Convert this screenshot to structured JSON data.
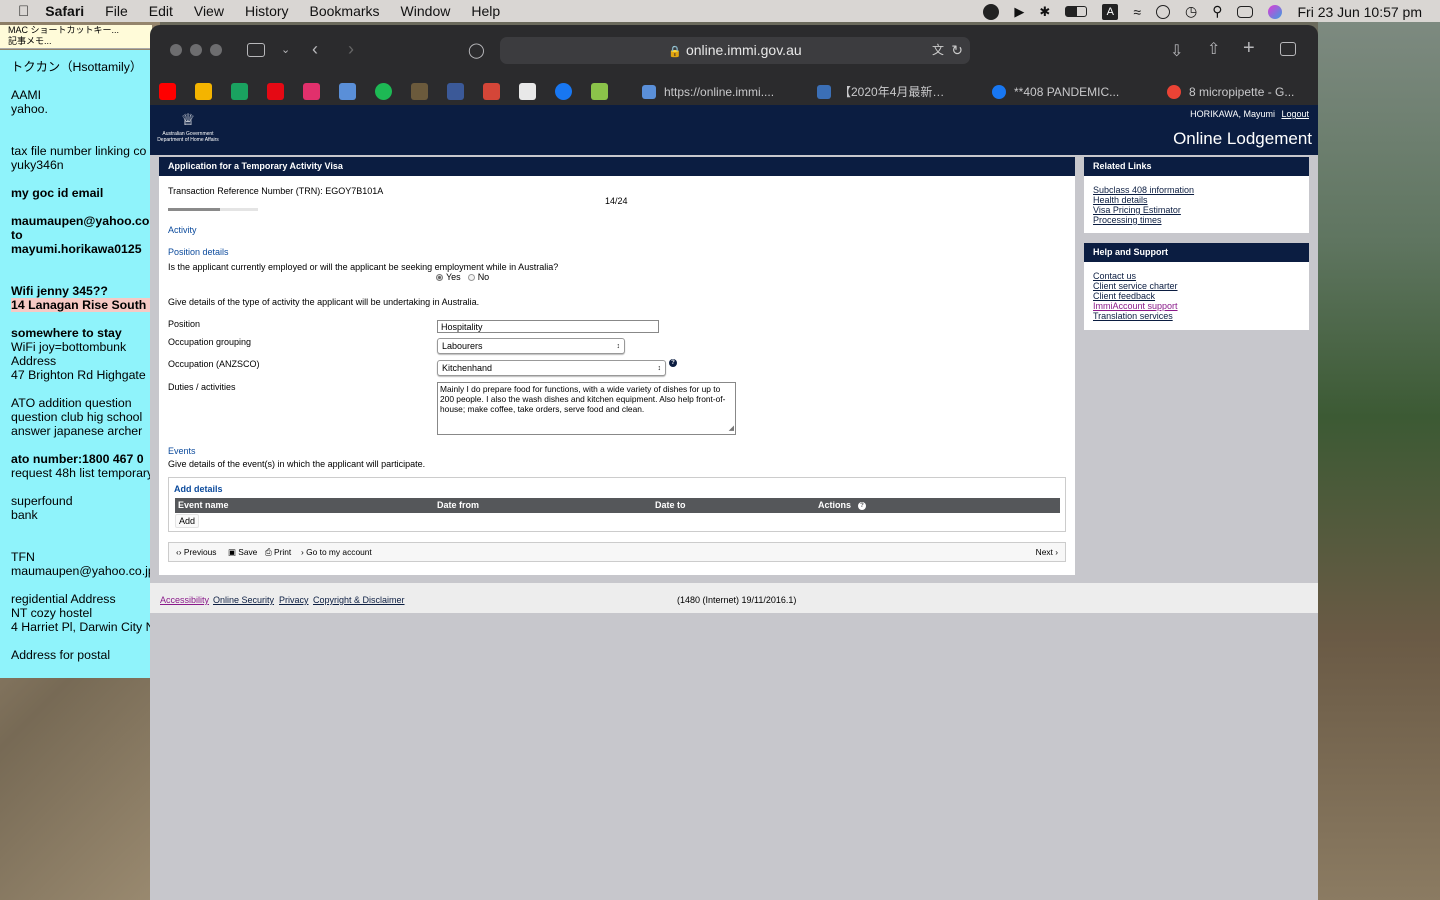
{
  "menubar": {
    "app_name": "Safari",
    "items": [
      "File",
      "Edit",
      "View",
      "History",
      "Bookmarks",
      "Window",
      "Help"
    ],
    "clock": "Fri 23 Jun  10:57 pm"
  },
  "memo": {
    "title_bar_1": "MAC ショートカットキー...",
    "title_bar_2": "記事メモ...",
    "lines": [
      "トクカン（Hsottamily）",
      "",
      "AAMI",
      "yahoo.",
      "",
      "",
      "tax file number linking co",
      "yuky346n",
      "",
      "my goc id email",
      "",
      "maumaupen@yahoo.co",
      "to",
      "mayumi.horikawa0125",
      "",
      "",
      "Wifi jenny 345??",
      "14 Lanagan Rise South",
      "",
      "somewhere to stay",
      "WiFi joy=bottombunk",
      "Address",
      "47 Brighton Rd Highgate",
      "",
      "ATO addition question",
      "question club hig school",
      "answer japanese archer",
      "",
      "ato number:1800 467 0",
      "request 48h list temporary",
      "",
      "superfound",
      "bank",
      "",
      "",
      "TFN",
      "maumaupen@yahoo.co.jp",
      "",
      "regidential Address",
      "NT cozy hostel",
      "4 Harriet Pl, Darwin City N",
      "",
      "Address for postal"
    ]
  },
  "browser": {
    "url": "online.immi.gov.au",
    "tabs": [
      {
        "label": "https://online.immi....",
        "color": "#5a8fd8"
      },
      {
        "label": "【2020年4月最新…",
        "color": "#3b6fb6"
      },
      {
        "label": "**408 PANDEMIC...",
        "color": "#1877f2"
      },
      {
        "label": "8 micropipette - G...",
        "color": "#ea4335"
      }
    ],
    "favorites_colors": [
      "#ff0000",
      "#f4b400",
      "#1aa260",
      "#e50914",
      "#e1306c",
      "#5a8fd8",
      "#1db954",
      "#6b5a3c",
      "#3b5998",
      "#d44638",
      "#e8e8e8",
      "#1877f2",
      "#8bc34a"
    ]
  },
  "header": {
    "gov_line1": "Australian Government",
    "gov_line2": "Department of Home Affairs",
    "user": "HORIKAWA, Mayumi",
    "logout": "Logout",
    "title": "Online Lodgement"
  },
  "form": {
    "panel_title": "Application for a Temporary Activity Visa",
    "trn": "Transaction Reference Number (TRN): EGOY7B101A",
    "progress_text": "14/24",
    "progress_fraction": 0.583,
    "section": "Activity",
    "subsection": "Position details",
    "question": "Is the applicant currently employed or will the applicant be seeking employment while in Australia?",
    "opt_yes": "Yes",
    "opt_no": "No",
    "selected": "Yes",
    "give_details": "Give details of the type of activity the applicant will be undertaking in Australia.",
    "position_label": "Position",
    "position_value": "Hospitality",
    "occgroup_label": "Occupation grouping",
    "occgroup_value": "Labourers",
    "anzsco_label": "Occupation (ANZSCO)",
    "anzsco_value": "Kitchenhand",
    "duties_label": "Duties / activities",
    "duties_value": "Mainly I do prepare food for functions, with a wide variety of dishes for up to 200 people. I also the wash dishes and kitchen equipment. Also help front-of-house;  make coffee, take orders,  serve food and clean.",
    "events_title": "Events",
    "events_text": "Give details of the event(s) in which the applicant will participate.",
    "add_details": "Add details",
    "table_headers": [
      "Event name",
      "Date from",
      "Date to",
      "Actions"
    ],
    "add_button": "Add",
    "nav": {
      "previous": "Previous",
      "save": "Save",
      "print": "Print",
      "goto": "Go to my account",
      "next": "Next"
    }
  },
  "related": {
    "title": "Related Links",
    "links": [
      "Subclass 408 information",
      "Health details",
      "Visa Pricing Estimator",
      "Processing times"
    ]
  },
  "help": {
    "title": "Help and Support",
    "links": [
      "Contact us",
      "Client service charter",
      "Client feedback",
      "ImmiAccount support",
      "Translation services"
    ]
  },
  "footer": {
    "links": [
      "Accessibility",
      "Online Security",
      "Privacy",
      "Copyright & Disclaimer"
    ],
    "version": "(1480 (Internet) 19/11/2016.1)"
  }
}
